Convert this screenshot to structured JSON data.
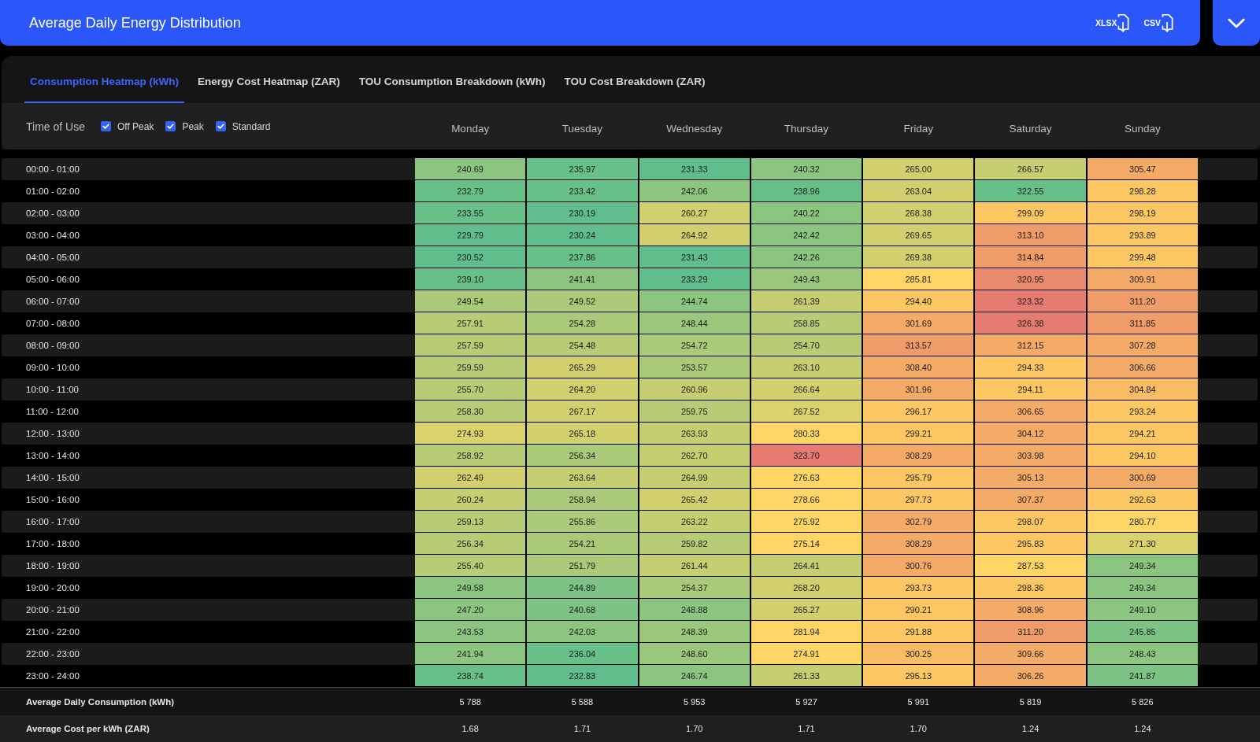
{
  "header": {
    "title": "Average Daily Energy Distribution",
    "exports": [
      {
        "label": "XLSX"
      },
      {
        "label": "CSV"
      }
    ]
  },
  "tabs": [
    {
      "label": "Consumption Heatmap (kWh)",
      "selected": true
    },
    {
      "label": "Energy Cost Heatmap (ZAR)",
      "selected": false
    },
    {
      "label": "TOU Consumption Breakdown (kWh)",
      "selected": false
    },
    {
      "label": "TOU Cost Breakdown (ZAR)",
      "selected": false
    }
  ],
  "filters": {
    "label": "Time of Use",
    "options": [
      {
        "label": "Off Peak",
        "checked": true
      },
      {
        "label": "Peak",
        "checked": true
      },
      {
        "label": "Standard",
        "checked": true
      }
    ]
  },
  "table": {
    "columns": [
      "Monday",
      "Tuesday",
      "Wednesday",
      "Thursday",
      "Friday",
      "Saturday",
      "Sunday"
    ],
    "rows": [
      {
        "time": "00:00 - 01:00",
        "cells": [
          {
            "value": "240.69",
            "color": "#8bc580"
          },
          {
            "value": "235.97",
            "color": "#68c089"
          },
          {
            "value": "231.33",
            "color": "#5fbe8b"
          },
          {
            "value": "240.32",
            "color": "#8bc580"
          },
          {
            "value": "265.00",
            "color": "#d2cf6f"
          },
          {
            "value": "266.57",
            "color": "#c6ce72"
          },
          {
            "value": "305.47",
            "color": "#f3ab67"
          }
        ]
      },
      {
        "time": "01:00 - 02:00",
        "cells": [
          {
            "value": "232.79",
            "color": "#68c089"
          },
          {
            "value": "233.42",
            "color": "#68c089"
          },
          {
            "value": "242.06",
            "color": "#8bc580"
          },
          {
            "value": "238.96",
            "color": "#68c089"
          },
          {
            "value": "263.04",
            "color": "#d2cf6f"
          },
          {
            "value": "322.55",
            "color": "#68c089"
          },
          {
            "value": "298.28",
            "color": "#fdc763"
          }
        ]
      },
      {
        "time": "02:00 - 03:00",
        "cells": [
          {
            "value": "233.55",
            "color": "#68c089"
          },
          {
            "value": "230.19",
            "color": "#5fbe8b"
          },
          {
            "value": "260.27",
            "color": "#d2cf6f"
          },
          {
            "value": "240.22",
            "color": "#8bc580"
          },
          {
            "value": "268.38",
            "color": "#d2cf6f"
          },
          {
            "value": "299.09",
            "color": "#fdc763"
          },
          {
            "value": "298.19",
            "color": "#fdc763"
          }
        ]
      },
      {
        "time": "03:00 - 04:00",
        "cells": [
          {
            "value": "229.79",
            "color": "#5fbe8b"
          },
          {
            "value": "230.24",
            "color": "#5fbe8b"
          },
          {
            "value": "264.92",
            "color": "#d2cf6f"
          },
          {
            "value": "242.42",
            "color": "#8bc580"
          },
          {
            "value": "269.65",
            "color": "#d2cf6f"
          },
          {
            "value": "313.10",
            "color": "#ef9c6a"
          },
          {
            "value": "293.89",
            "color": "#fdc763"
          }
        ]
      },
      {
        "time": "04:00 - 05:00",
        "cells": [
          {
            "value": "230.52",
            "color": "#5fbe8b"
          },
          {
            "value": "237.86",
            "color": "#68c089"
          },
          {
            "value": "231.43",
            "color": "#5fbe8b"
          },
          {
            "value": "242.26",
            "color": "#8bc580"
          },
          {
            "value": "269.38",
            "color": "#d2cf6f"
          },
          {
            "value": "314.84",
            "color": "#ef9c6a"
          },
          {
            "value": "299.48",
            "color": "#fdc763"
          }
        ]
      },
      {
        "time": "05:00 - 06:00",
        "cells": [
          {
            "value": "239.10",
            "color": "#68c089"
          },
          {
            "value": "241.41",
            "color": "#8bc580"
          },
          {
            "value": "233.29",
            "color": "#5fbe8b"
          },
          {
            "value": "249.43",
            "color": "#9ac77c"
          },
          {
            "value": "285.81",
            "color": "#ffd666"
          },
          {
            "value": "320.95",
            "color": "#ea8a6d"
          },
          {
            "value": "309.91",
            "color": "#f3ab67"
          }
        ]
      },
      {
        "time": "06:00 - 07:00",
        "cells": [
          {
            "value": "249.54",
            "color": "#aac979"
          },
          {
            "value": "249.52",
            "color": "#aac979"
          },
          {
            "value": "244.74",
            "color": "#8bc580"
          },
          {
            "value": "261.39",
            "color": "#c6ce72"
          },
          {
            "value": "294.40",
            "color": "#fdc763"
          },
          {
            "value": "323.32",
            "color": "#e67b71"
          },
          {
            "value": "311.20",
            "color": "#ef9c6a"
          }
        ]
      },
      {
        "time": "07:00 - 08:00",
        "cells": [
          {
            "value": "257.91",
            "color": "#b8cb76"
          },
          {
            "value": "254.28",
            "color": "#aac979"
          },
          {
            "value": "248.44",
            "color": "#9ac77c"
          },
          {
            "value": "258.85",
            "color": "#b8cb76"
          },
          {
            "value": "301.69",
            "color": "#f3ab67"
          },
          {
            "value": "326.38",
            "color": "#e67b71"
          },
          {
            "value": "311.85",
            "color": "#ef9c6a"
          }
        ]
      },
      {
        "time": "08:00 - 09:00",
        "cells": [
          {
            "value": "257.59",
            "color": "#b8cb76"
          },
          {
            "value": "254.48",
            "color": "#b8cb76"
          },
          {
            "value": "254.72",
            "color": "#aac979"
          },
          {
            "value": "254.70",
            "color": "#b8cb76"
          },
          {
            "value": "313.57",
            "color": "#ef9c6a"
          },
          {
            "value": "312.15",
            "color": "#f3ab67"
          },
          {
            "value": "307.28",
            "color": "#f3ab67"
          }
        ]
      },
      {
        "time": "09:00 - 10:00",
        "cells": [
          {
            "value": "259.59",
            "color": "#b8cb76"
          },
          {
            "value": "265.29",
            "color": "#d2cf6f"
          },
          {
            "value": "253.57",
            "color": "#aac979"
          },
          {
            "value": "263.10",
            "color": "#c6ce72"
          },
          {
            "value": "308.40",
            "color": "#f3ab67"
          },
          {
            "value": "294.33",
            "color": "#fdc763"
          },
          {
            "value": "306.66",
            "color": "#f3ab67"
          }
        ]
      },
      {
        "time": "10:00 - 11:00",
        "cells": [
          {
            "value": "255.70",
            "color": "#b8cb76"
          },
          {
            "value": "264.20",
            "color": "#d2cf6f"
          },
          {
            "value": "260.96",
            "color": "#c6ce72"
          },
          {
            "value": "266.64",
            "color": "#d2cf6f"
          },
          {
            "value": "301.96",
            "color": "#f3ab67"
          },
          {
            "value": "294.11",
            "color": "#fdc763"
          },
          {
            "value": "304.84",
            "color": "#f9bb64"
          }
        ]
      },
      {
        "time": "11:00 - 12:00",
        "cells": [
          {
            "value": "258.30",
            "color": "#b8cb76"
          },
          {
            "value": "267.17",
            "color": "#d2cf6f"
          },
          {
            "value": "259.75",
            "color": "#b8cb76"
          },
          {
            "value": "267.52",
            "color": "#dad26d"
          },
          {
            "value": "296.17",
            "color": "#fdc763"
          },
          {
            "value": "306.65",
            "color": "#f3ab67"
          },
          {
            "value": "293.24",
            "color": "#fdc763"
          }
        ]
      },
      {
        "time": "12:00 - 13:00",
        "cells": [
          {
            "value": "274.93",
            "color": "#dad26d"
          },
          {
            "value": "265.18",
            "color": "#d2cf6f"
          },
          {
            "value": "263.93",
            "color": "#c6ce72"
          },
          {
            "value": "280.33",
            "color": "#ffd666"
          },
          {
            "value": "299.21",
            "color": "#fdc763"
          },
          {
            "value": "304.12",
            "color": "#f3ab67"
          },
          {
            "value": "294.21",
            "color": "#fdc763"
          }
        ]
      },
      {
        "time": "13:00 - 14:00",
        "cells": [
          {
            "value": "258.92",
            "color": "#b8cb76"
          },
          {
            "value": "256.34",
            "color": "#aac979"
          },
          {
            "value": "262.70",
            "color": "#c6ce72"
          },
          {
            "value": "323.70",
            "color": "#e67b71"
          },
          {
            "value": "308.29",
            "color": "#f3ab67"
          },
          {
            "value": "303.98",
            "color": "#f3ab67"
          },
          {
            "value": "294.10",
            "color": "#fdc763"
          }
        ]
      },
      {
        "time": "14:00 - 15:00",
        "cells": [
          {
            "value": "262.49",
            "color": "#d2cf6f"
          },
          {
            "value": "263.64",
            "color": "#c6ce72"
          },
          {
            "value": "264.99",
            "color": "#c6ce72"
          },
          {
            "value": "276.63",
            "color": "#ffd666"
          },
          {
            "value": "295.79",
            "color": "#fdc763"
          },
          {
            "value": "305.13",
            "color": "#f3ab67"
          },
          {
            "value": "300.69",
            "color": "#f3ab67"
          }
        ]
      },
      {
        "time": "15:00 - 16:00",
        "cells": [
          {
            "value": "260.24",
            "color": "#c6ce72"
          },
          {
            "value": "258.94",
            "color": "#aac979"
          },
          {
            "value": "265.42",
            "color": "#d2cf6f"
          },
          {
            "value": "278.66",
            "color": "#ffd666"
          },
          {
            "value": "297.73",
            "color": "#fdc763"
          },
          {
            "value": "307.37",
            "color": "#f3ab67"
          },
          {
            "value": "292.63",
            "color": "#fdc763"
          }
        ]
      },
      {
        "time": "16:00 - 17:00",
        "cells": [
          {
            "value": "259.13",
            "color": "#b8cb76"
          },
          {
            "value": "255.86",
            "color": "#aac979"
          },
          {
            "value": "263.22",
            "color": "#c6ce72"
          },
          {
            "value": "275.92",
            "color": "#ffd666"
          },
          {
            "value": "302.79",
            "color": "#f3ab67"
          },
          {
            "value": "298.07",
            "color": "#fdc763"
          },
          {
            "value": "280.77",
            "color": "#ffd666"
          }
        ]
      },
      {
        "time": "17:00 - 18:00",
        "cells": [
          {
            "value": "256.34",
            "color": "#b8cb76"
          },
          {
            "value": "254.21",
            "color": "#aac979"
          },
          {
            "value": "259.82",
            "color": "#b8cb76"
          },
          {
            "value": "275.14",
            "color": "#ffd666"
          },
          {
            "value": "308.29",
            "color": "#f3ab67"
          },
          {
            "value": "295.83",
            "color": "#fdc763"
          },
          {
            "value": "271.30",
            "color": "#dad26d"
          }
        ]
      },
      {
        "time": "18:00 - 19:00",
        "cells": [
          {
            "value": "255.40",
            "color": "#b8cb76"
          },
          {
            "value": "251.79",
            "color": "#aac979"
          },
          {
            "value": "261.44",
            "color": "#c6ce72"
          },
          {
            "value": "264.41",
            "color": "#c6ce72"
          },
          {
            "value": "300.76",
            "color": "#f3ab67"
          },
          {
            "value": "287.53",
            "color": "#ffd666"
          },
          {
            "value": "249.34",
            "color": "#8bc580"
          }
        ]
      },
      {
        "time": "19:00 - 20:00",
        "cells": [
          {
            "value": "249.58",
            "color": "#8bc580"
          },
          {
            "value": "244.89",
            "color": "#7cc385"
          },
          {
            "value": "254.37",
            "color": "#aac979"
          },
          {
            "value": "268.20",
            "color": "#d2cf6f"
          },
          {
            "value": "293.73",
            "color": "#fdc763"
          },
          {
            "value": "298.36",
            "color": "#fdc763"
          },
          {
            "value": "249.34",
            "color": "#8bc580"
          }
        ]
      },
      {
        "time": "20:00 - 21:00",
        "cells": [
          {
            "value": "247.20",
            "color": "#8bc580"
          },
          {
            "value": "240.68",
            "color": "#7cc385"
          },
          {
            "value": "248.88",
            "color": "#8bc580"
          },
          {
            "value": "265.27",
            "color": "#d2cf6f"
          },
          {
            "value": "290.21",
            "color": "#fdc763"
          },
          {
            "value": "308.96",
            "color": "#f3ab67"
          },
          {
            "value": "249.10",
            "color": "#8bc580"
          }
        ]
      },
      {
        "time": "21:00 - 22:00",
        "cells": [
          {
            "value": "243.53",
            "color": "#8bc580"
          },
          {
            "value": "242.03",
            "color": "#8bc580"
          },
          {
            "value": "248.39",
            "color": "#9ac77c"
          },
          {
            "value": "281.94",
            "color": "#ffd666"
          },
          {
            "value": "291.88",
            "color": "#fdc763"
          },
          {
            "value": "311.20",
            "color": "#ef9c6a"
          },
          {
            "value": "245.85",
            "color": "#7cc385"
          }
        ]
      },
      {
        "time": "22:00 - 23:00",
        "cells": [
          {
            "value": "241.94",
            "color": "#8bc580"
          },
          {
            "value": "236.04",
            "color": "#68c089"
          },
          {
            "value": "248.60",
            "color": "#9ac77c"
          },
          {
            "value": "274.91",
            "color": "#ffd666"
          },
          {
            "value": "300.25",
            "color": "#f9bb64"
          },
          {
            "value": "309.66",
            "color": "#f3ab67"
          },
          {
            "value": "248.43",
            "color": "#8bc580"
          }
        ]
      },
      {
        "time": "23:00 - 24:00",
        "cells": [
          {
            "value": "238.74",
            "color": "#68c089"
          },
          {
            "value": "232.83",
            "color": "#5fbe8b"
          },
          {
            "value": "246.74",
            "color": "#8bc580"
          },
          {
            "value": "261.33",
            "color": "#c6ce72"
          },
          {
            "value": "295.13",
            "color": "#fdc763"
          },
          {
            "value": "306.26",
            "color": "#f3ab67"
          },
          {
            "value": "241.87",
            "color": "#7cc385"
          }
        ]
      }
    ],
    "summary": [
      {
        "label": "Average Daily Consumption (kWh)",
        "values": [
          "5 788",
          "5 588",
          "5 953",
          "5 927",
          "5 991",
          "5 819",
          "5 826"
        ]
      },
      {
        "label": "Average Cost per kWh (ZAR)",
        "values": [
          "1.68",
          "1.71",
          "1.70",
          "1.71",
          "1.70",
          "1.24",
          "1.24"
        ]
      }
    ]
  }
}
